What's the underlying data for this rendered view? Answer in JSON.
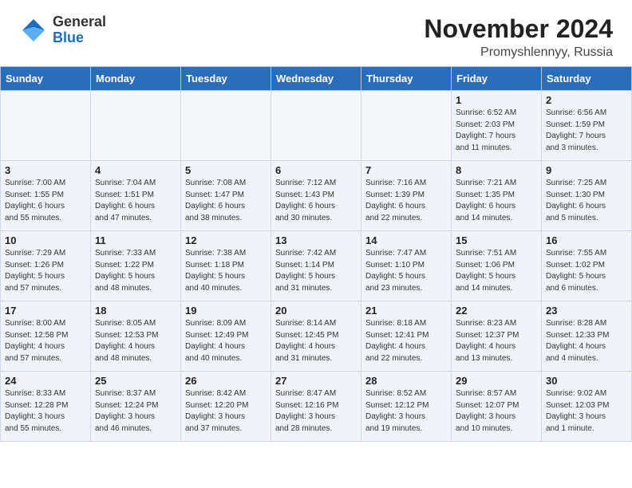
{
  "header": {
    "logo_general": "General",
    "logo_blue": "Blue",
    "month": "November 2024",
    "location": "Promyshlennyy, Russia"
  },
  "weekdays": [
    "Sunday",
    "Monday",
    "Tuesday",
    "Wednesday",
    "Thursday",
    "Friday",
    "Saturday"
  ],
  "weeks": [
    [
      {
        "day": "",
        "detail": ""
      },
      {
        "day": "",
        "detail": ""
      },
      {
        "day": "",
        "detail": ""
      },
      {
        "day": "",
        "detail": ""
      },
      {
        "day": "",
        "detail": ""
      },
      {
        "day": "1",
        "detail": "Sunrise: 6:52 AM\nSunset: 2:03 PM\nDaylight: 7 hours\nand 11 minutes."
      },
      {
        "day": "2",
        "detail": "Sunrise: 6:56 AM\nSunset: 1:59 PM\nDaylight: 7 hours\nand 3 minutes."
      }
    ],
    [
      {
        "day": "3",
        "detail": "Sunrise: 7:00 AM\nSunset: 1:55 PM\nDaylight: 6 hours\nand 55 minutes."
      },
      {
        "day": "4",
        "detail": "Sunrise: 7:04 AM\nSunset: 1:51 PM\nDaylight: 6 hours\nand 47 minutes."
      },
      {
        "day": "5",
        "detail": "Sunrise: 7:08 AM\nSunset: 1:47 PM\nDaylight: 6 hours\nand 38 minutes."
      },
      {
        "day": "6",
        "detail": "Sunrise: 7:12 AM\nSunset: 1:43 PM\nDaylight: 6 hours\nand 30 minutes."
      },
      {
        "day": "7",
        "detail": "Sunrise: 7:16 AM\nSunset: 1:39 PM\nDaylight: 6 hours\nand 22 minutes."
      },
      {
        "day": "8",
        "detail": "Sunrise: 7:21 AM\nSunset: 1:35 PM\nDaylight: 6 hours\nand 14 minutes."
      },
      {
        "day": "9",
        "detail": "Sunrise: 7:25 AM\nSunset: 1:30 PM\nDaylight: 6 hours\nand 5 minutes."
      }
    ],
    [
      {
        "day": "10",
        "detail": "Sunrise: 7:29 AM\nSunset: 1:26 PM\nDaylight: 5 hours\nand 57 minutes."
      },
      {
        "day": "11",
        "detail": "Sunrise: 7:33 AM\nSunset: 1:22 PM\nDaylight: 5 hours\nand 48 minutes."
      },
      {
        "day": "12",
        "detail": "Sunrise: 7:38 AM\nSunset: 1:18 PM\nDaylight: 5 hours\nand 40 minutes."
      },
      {
        "day": "13",
        "detail": "Sunrise: 7:42 AM\nSunset: 1:14 PM\nDaylight: 5 hours\nand 31 minutes."
      },
      {
        "day": "14",
        "detail": "Sunrise: 7:47 AM\nSunset: 1:10 PM\nDaylight: 5 hours\nand 23 minutes."
      },
      {
        "day": "15",
        "detail": "Sunrise: 7:51 AM\nSunset: 1:06 PM\nDaylight: 5 hours\nand 14 minutes."
      },
      {
        "day": "16",
        "detail": "Sunrise: 7:55 AM\nSunset: 1:02 PM\nDaylight: 5 hours\nand 6 minutes."
      }
    ],
    [
      {
        "day": "17",
        "detail": "Sunrise: 8:00 AM\nSunset: 12:58 PM\nDaylight: 4 hours\nand 57 minutes."
      },
      {
        "day": "18",
        "detail": "Sunrise: 8:05 AM\nSunset: 12:53 PM\nDaylight: 4 hours\nand 48 minutes."
      },
      {
        "day": "19",
        "detail": "Sunrise: 8:09 AM\nSunset: 12:49 PM\nDaylight: 4 hours\nand 40 minutes."
      },
      {
        "day": "20",
        "detail": "Sunrise: 8:14 AM\nSunset: 12:45 PM\nDaylight: 4 hours\nand 31 minutes."
      },
      {
        "day": "21",
        "detail": "Sunrise: 8:18 AM\nSunset: 12:41 PM\nDaylight: 4 hours\nand 22 minutes."
      },
      {
        "day": "22",
        "detail": "Sunrise: 8:23 AM\nSunset: 12:37 PM\nDaylight: 4 hours\nand 13 minutes."
      },
      {
        "day": "23",
        "detail": "Sunrise: 8:28 AM\nSunset: 12:33 PM\nDaylight: 4 hours\nand 4 minutes."
      }
    ],
    [
      {
        "day": "24",
        "detail": "Sunrise: 8:33 AM\nSunset: 12:28 PM\nDaylight: 3 hours\nand 55 minutes."
      },
      {
        "day": "25",
        "detail": "Sunrise: 8:37 AM\nSunset: 12:24 PM\nDaylight: 3 hours\nand 46 minutes."
      },
      {
        "day": "26",
        "detail": "Sunrise: 8:42 AM\nSunset: 12:20 PM\nDaylight: 3 hours\nand 37 minutes."
      },
      {
        "day": "27",
        "detail": "Sunrise: 8:47 AM\nSunset: 12:16 PM\nDaylight: 3 hours\nand 28 minutes."
      },
      {
        "day": "28",
        "detail": "Sunrise: 8:52 AM\nSunset: 12:12 PM\nDaylight: 3 hours\nand 19 minutes."
      },
      {
        "day": "29",
        "detail": "Sunrise: 8:57 AM\nSunset: 12:07 PM\nDaylight: 3 hours\nand 10 minutes."
      },
      {
        "day": "30",
        "detail": "Sunrise: 9:02 AM\nSunset: 12:03 PM\nDaylight: 3 hours\nand 1 minute."
      }
    ]
  ]
}
